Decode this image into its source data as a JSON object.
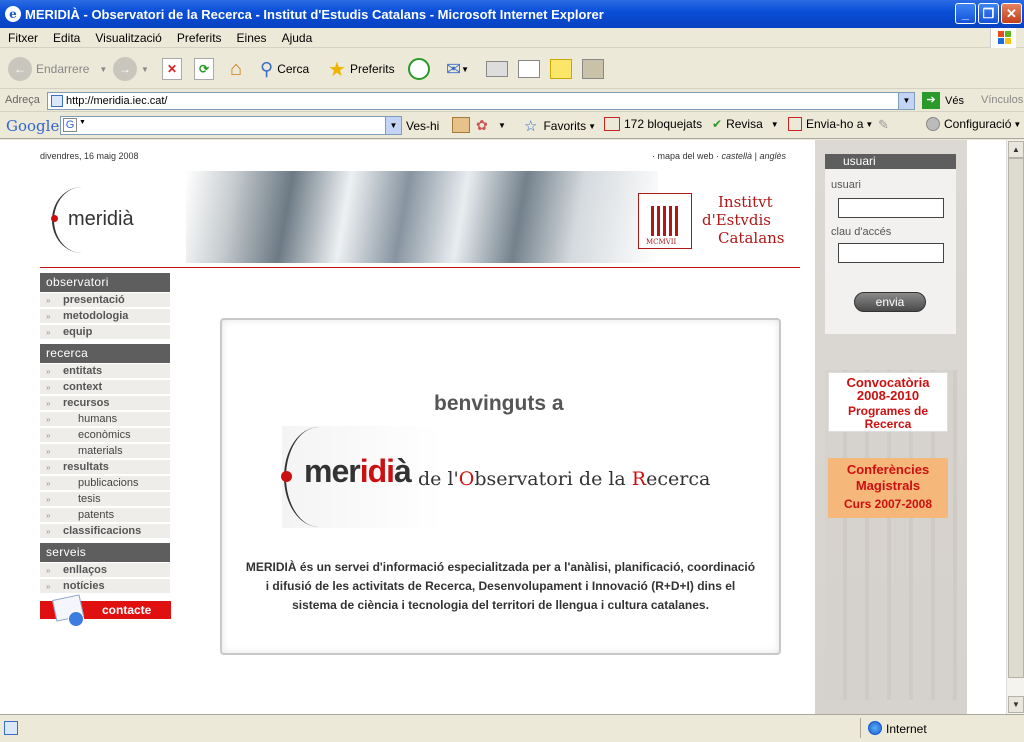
{
  "window": {
    "title": "MERIDIÀ - Observatori de la Recerca - Institut d'Estudis Catalans - Microsoft Internet Explorer"
  },
  "menu": [
    "Fitxer",
    "Edita",
    "Visualització",
    "Preferits",
    "Eines",
    "Ajuda"
  ],
  "toolbar": {
    "back": "Endarrere",
    "search": "Cerca",
    "favorites": "Preferits"
  },
  "address": {
    "label": "Adreça",
    "url": "http://meridia.iec.cat/",
    "go": "Vés",
    "links": "Vínculos"
  },
  "google_bar": {
    "logo": "Google",
    "go": "Ves-hi",
    "favorites": "Favorits",
    "blocked": "172 bloquejats",
    "check": "Revisa",
    "send": "Envia-ho a",
    "settings": "Configuració"
  },
  "page": {
    "date": "divendres, 16 maig 2008",
    "toplinks": {
      "sitemap": "· mapa del web ·",
      "castella": "castellà",
      "sep": "|",
      "angles": "anglès"
    },
    "logo_text": "meridià",
    "iec_logo": {
      "line1": "Institvt",
      "line2": "d'Estvdis",
      "line3": "Catalans",
      "seal": "MCMVII"
    },
    "nav": {
      "observatori": {
        "title": "observatori",
        "items": [
          "presentació",
          "metodologia",
          "equip"
        ]
      },
      "recerca": {
        "title": "recerca",
        "items": [
          "entitats",
          "context",
          "recursos",
          "humans",
          "econòmics",
          "materials",
          "resultats",
          "publicacions",
          "tesis",
          "patents",
          "classificacions"
        ]
      },
      "serveis": {
        "title": "serveis",
        "items": [
          "enllaços",
          "notícies"
        ]
      },
      "contact": "contacte"
    },
    "welcome": {
      "heading": "benvinguts a",
      "brand_a": "mer",
      "brand_b": "idi",
      "brand_c": "à",
      "tagline_1": "de l'",
      "tagline_O": "O",
      "tagline_2": "bservatori de la ",
      "tagline_R": "R",
      "tagline_3": "ecerca",
      "body_1": "MERIDIÀ és un servei d'informació especialitzada per a l'anàlisi, planificació, coordinació",
      "body_2": "i difusió de les activitats de Recerca, Desenvolupament i Innovació (R+D+I) dins el",
      "body_3": "sistema de ciència i tecnologia del territori de llengua i cultura catalanes."
    },
    "login": {
      "title": "usuari",
      "user_label": "usuari",
      "pass_label": "clau d'accés",
      "submit": "envia"
    },
    "banners": {
      "convocatoria_1": "Convocatòria",
      "convocatoria_2": "2008-2010",
      "convocatoria_3": "Programes de",
      "convocatoria_4": "Recerca",
      "conferencies_1": "Conferències",
      "conferencies_2": "Magistrals",
      "conferencies_3": "Curs 2007-2008"
    }
  },
  "status": {
    "zone": "Internet"
  },
  "colors": {
    "accent_red": "#cc1010",
    "nav_header": "#5e5e5e"
  }
}
